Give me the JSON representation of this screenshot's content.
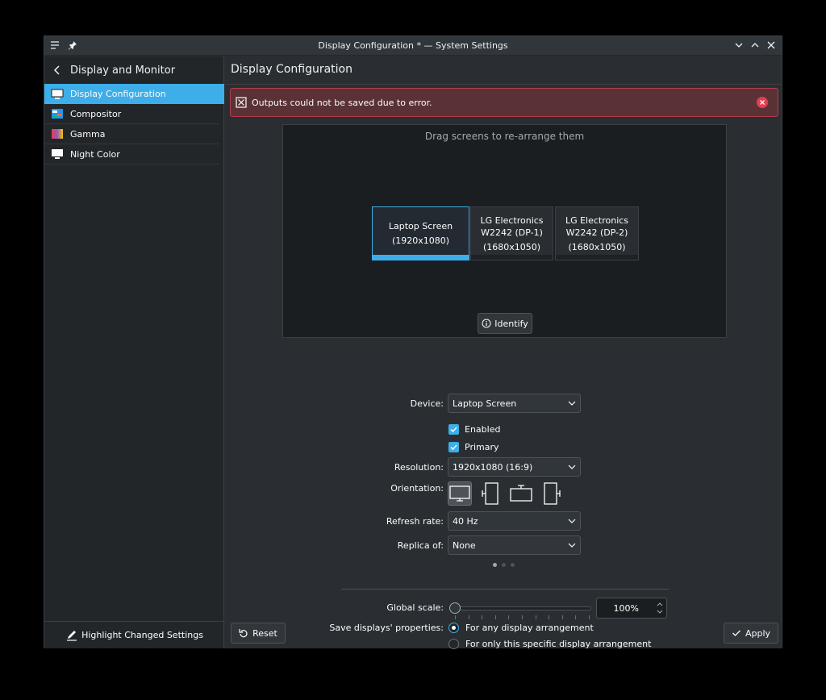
{
  "window": {
    "title": "Display Configuration * — System Settings"
  },
  "sidebar": {
    "header": "Display and Monitor",
    "items": [
      {
        "label": "Display Configuration",
        "icon": "monitor-icon"
      },
      {
        "label": "Compositor",
        "icon": "compositor-icon"
      },
      {
        "label": "Gamma",
        "icon": "gamma-icon"
      },
      {
        "label": "Night Color",
        "icon": "night-color-icon"
      }
    ],
    "footer": "Highlight Changed Settings"
  },
  "main": {
    "title": "Display Configuration",
    "error": "Outputs could not be saved due to error.",
    "arrange_hint": "Drag screens to re-arrange them",
    "screens": [
      {
        "name": "Laptop Screen",
        "resolution": "(1920x1080)"
      },
      {
        "name": "LG Electronics W2242 (DP-1)",
        "resolution": "(1680x1050)"
      },
      {
        "name": "LG Electronics W2242 (DP-2)",
        "resolution": "(1680x1050)"
      }
    ],
    "identify_label": "Identify"
  },
  "form": {
    "device_label": "Device:",
    "device_value": "Laptop Screen",
    "enabled_label": "Enabled",
    "primary_label": "Primary",
    "resolution_label": "Resolution:",
    "resolution_value": "1920x1080 (16:9)",
    "orientation_label": "Orientation:",
    "refresh_label": "Refresh rate:",
    "refresh_value": "40 Hz",
    "replica_label": "Replica of:",
    "replica_value": "None",
    "scale_label": "Global scale:",
    "scale_value": "100%",
    "save_label": "Save displays' properties:",
    "save_option_any": "For any display arrangement",
    "save_option_specific": "For only this specific display arrangement"
  },
  "buttons": {
    "reset": "Reset",
    "apply": "Apply"
  },
  "colors": {
    "accent": "#3daee9",
    "error_bg": "#5a3236",
    "error_border": "#b03e4a",
    "error_icon": "#e33f50"
  }
}
